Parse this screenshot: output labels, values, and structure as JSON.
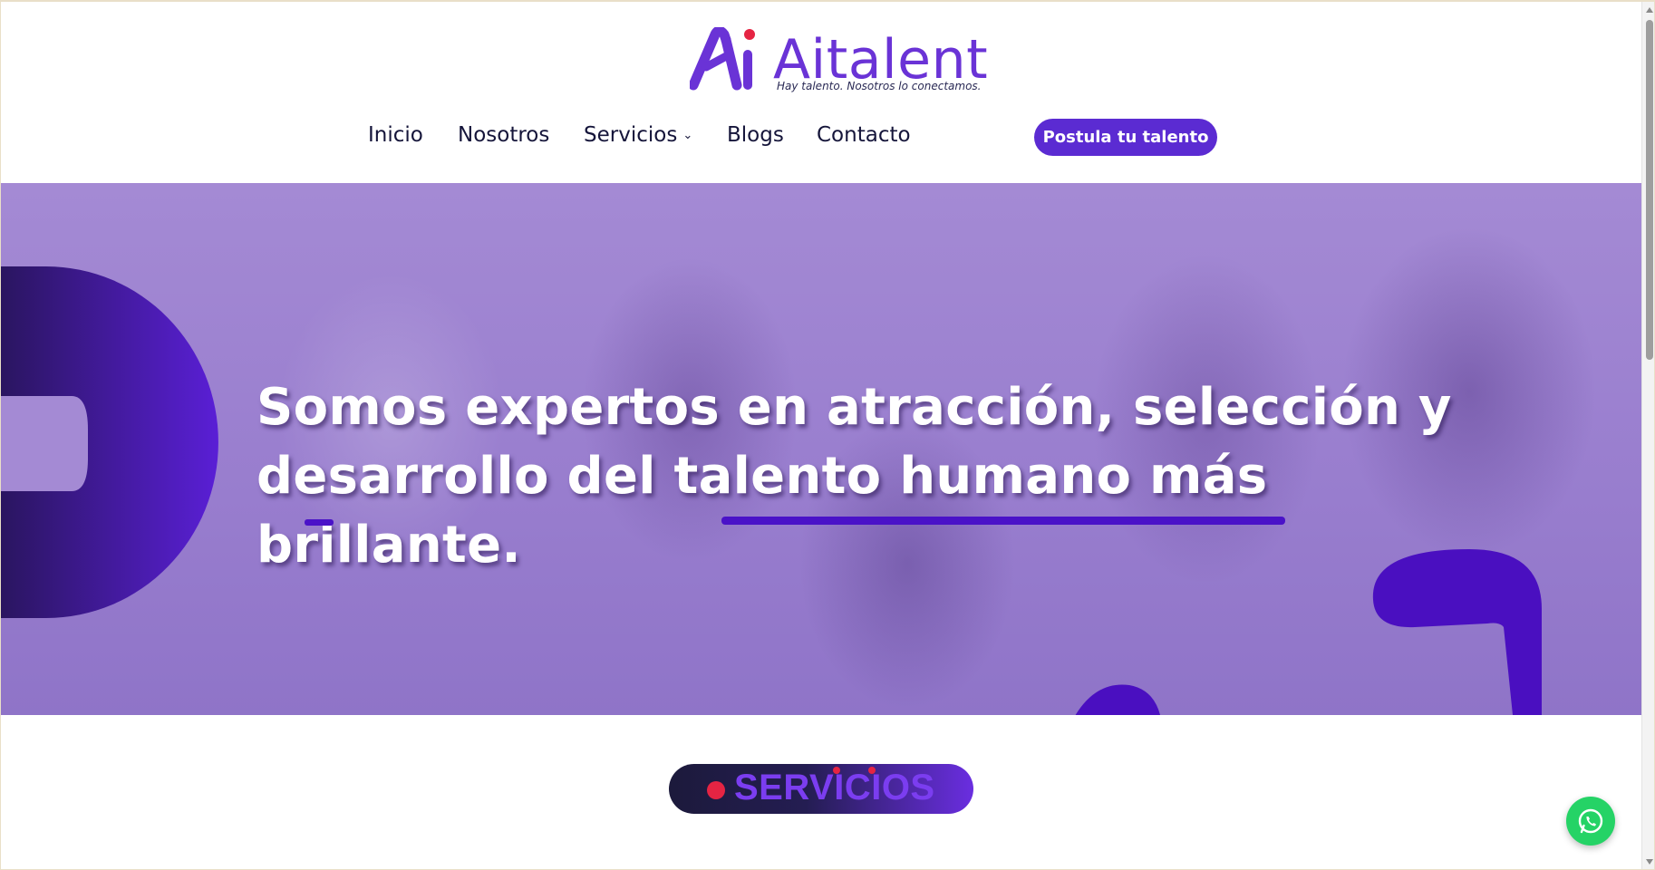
{
  "brand": {
    "name": "Aitalent",
    "tagline": "Hay talento. Nosotros lo conectamos.",
    "primary_color": "#5b2bd2",
    "accent_color": "#e52443"
  },
  "nav": {
    "items": [
      {
        "label": "Inicio"
      },
      {
        "label": "Nosotros"
      },
      {
        "label": "Servicios",
        "has_dropdown": true
      },
      {
        "label": "Blogs"
      },
      {
        "label": "Contacto"
      }
    ],
    "dropdown_caret": "⌄",
    "cta_label": "Postula tu talento"
  },
  "hero": {
    "line1": "Somos expertos en atracción, selección  y",
    "line2": "desarrollo del talento humano más brillante."
  },
  "services": {
    "heading": "SERVICIOS"
  },
  "floating": {
    "whatsapp_icon": "whatsapp-icon"
  }
}
